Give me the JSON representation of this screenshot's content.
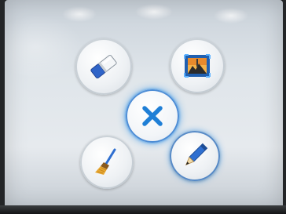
{
  "photo": {
    "screen_background": "#e2e7ec",
    "accent_glow": "#3c96e6"
  },
  "radial_menu": {
    "tools": [
      {
        "id": "eraser",
        "icon": "eraser-icon"
      },
      {
        "id": "picture",
        "icon": "picture-frame-icon"
      },
      {
        "id": "close",
        "icon": "close-icon",
        "color": "#1f7fd6"
      },
      {
        "id": "broom",
        "icon": "broom-icon"
      },
      {
        "id": "pen",
        "icon": "pen-icon",
        "selected": true
      }
    ]
  }
}
